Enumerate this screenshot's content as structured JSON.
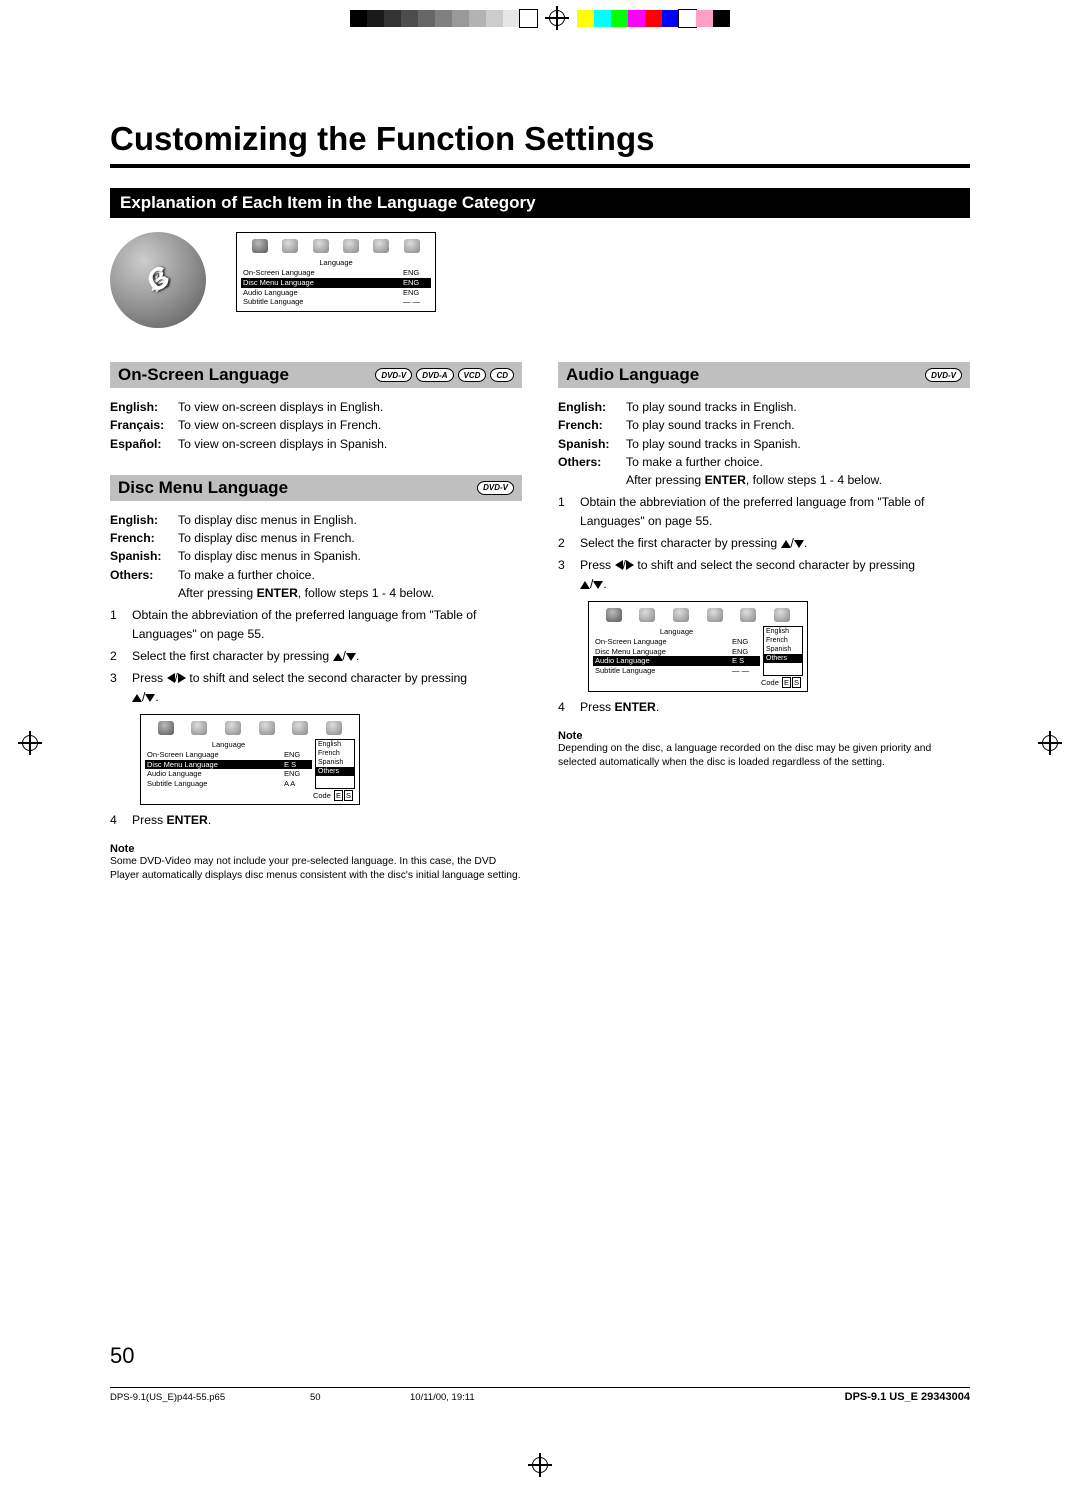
{
  "calibration": {
    "grays": [
      "#000000",
      "#1a1a1a",
      "#333333",
      "#4d4d4d",
      "#666666",
      "#808080",
      "#999999",
      "#b3b3b3",
      "#cccccc",
      "#e6e6e6",
      "#ffffff"
    ],
    "colors": [
      "#ffff00",
      "#00ffff",
      "#00ff00",
      "#ff00ff",
      "#ff0000",
      "#0000ff",
      "#ffffff",
      "#ff9ec7",
      "#000000"
    ]
  },
  "title": "Customizing the Function Settings",
  "black_bar": "Explanation of Each Item in the Language Category",
  "abc_label": "ABC",
  "osd_top": {
    "category": "Language",
    "rows": [
      {
        "lab": "On-Screen Language",
        "val": "ENG",
        "sel": false
      },
      {
        "lab": "Disc Menu Language",
        "val": "ENG",
        "sel": true
      },
      {
        "lab": "Audio Language",
        "val": "ENG",
        "sel": false
      },
      {
        "lab": "Subtitle Language",
        "val": "— —",
        "sel": false
      }
    ]
  },
  "onscreen": {
    "title": "On-Screen Language",
    "badges": [
      "DVD-V",
      "DVD-A",
      "VCD",
      "CD"
    ],
    "items": [
      {
        "term": "English:",
        "desc": "To view on-screen displays in English."
      },
      {
        "term": "Français:",
        "desc": "To view on-screen displays in French."
      },
      {
        "term": "Español:",
        "desc": "To view on-screen displays in Spanish."
      }
    ]
  },
  "discmenu": {
    "title": "Disc Menu Language",
    "badges": [
      "DVD-V"
    ],
    "items": [
      {
        "term": "English:",
        "desc": "To display disc menus in English."
      },
      {
        "term": "French:",
        "desc": "To display disc menus in French."
      },
      {
        "term": "Spanish:",
        "desc": "To display disc menus in Spanish."
      },
      {
        "term": "Others:",
        "desc": "To make a further choice."
      }
    ],
    "after_text_pre": "After pressing ",
    "after_text_btn": "ENTER",
    "after_text_post": ", follow steps 1 - 4 below.",
    "step1": "Obtain the abbreviation of the preferred language from \"Table of Languages\" on page 55.",
    "step2_pre": "Select the first character by pressing ",
    "step3_pre": "Press ",
    "step3_mid": " to shift and select the second character by pressing ",
    "step4_pre": "Press ",
    "step4_btn": "ENTER",
    "step4_post": ".",
    "osd": {
      "category": "Language",
      "rows": [
        {
          "lab": "On-Screen Language",
          "val": "ENG",
          "sel": false
        },
        {
          "lab": "Disc Menu Language",
          "val": "E S",
          "sel": true
        },
        {
          "lab": "Audio Language",
          "val": "ENG",
          "sel": false
        },
        {
          "lab": "Subtitle Language",
          "val": "A A",
          "sel": false
        }
      ],
      "side": [
        "English",
        "French",
        "Spanish",
        "Others"
      ],
      "side_sel": 3,
      "code_label": "Code",
      "code_chars": [
        "E",
        "S"
      ]
    },
    "note_label": "Note",
    "note": "Some DVD-Video may not include your pre-selected language. In this case, the DVD Player automatically displays disc menus consistent with the disc's initial language setting."
  },
  "audio": {
    "title": "Audio Language",
    "badges": [
      "DVD-V"
    ],
    "items": [
      {
        "term": "English:",
        "desc": "To play sound tracks in English."
      },
      {
        "term": "French:",
        "desc": "To play sound tracks in French."
      },
      {
        "term": "Spanish:",
        "desc": "To play sound tracks in Spanish."
      },
      {
        "term": "Others:",
        "desc": "To make a further choice."
      }
    ],
    "after_text_pre": "After pressing ",
    "after_text_btn": "ENTER",
    "after_text_post": ", follow steps 1 - 4 below.",
    "step1": "Obtain the abbreviation of the preferred language from \"Table of Languages\" on page 55.",
    "step2_pre": "Select the first character by pressing ",
    "step3_pre": "Press ",
    "step3_mid": " to shift and select the second character by pressing ",
    "step4_pre": "Press ",
    "step4_btn": "ENTER",
    "step4_post": ".",
    "osd": {
      "category": "Language",
      "rows": [
        {
          "lab": "On-Screen Language",
          "val": "ENG",
          "sel": false
        },
        {
          "lab": "Disc Menu Language",
          "val": "ENG",
          "sel": false
        },
        {
          "lab": "Audio Language",
          "val": "E S",
          "sel": true
        },
        {
          "lab": "Subtitle Language",
          "val": "— —",
          "sel": false
        }
      ],
      "side": [
        "English",
        "French",
        "Spanish",
        "Others"
      ],
      "side_sel": 3,
      "code_label": "Code",
      "code_chars": [
        "E",
        "S"
      ]
    },
    "note_label": "Note",
    "note": "Depending on the disc, a language recorded on the disc may be given priority and selected automatically when the disc is loaded regardless of the setting."
  },
  "page_number": "50",
  "footer": {
    "fname": "DPS-9.1(US_E)p44-55.p65",
    "fpage": "50",
    "fdate": "10/11/00, 19:11",
    "fcode": "DPS-9.1 US_E   29343004"
  }
}
